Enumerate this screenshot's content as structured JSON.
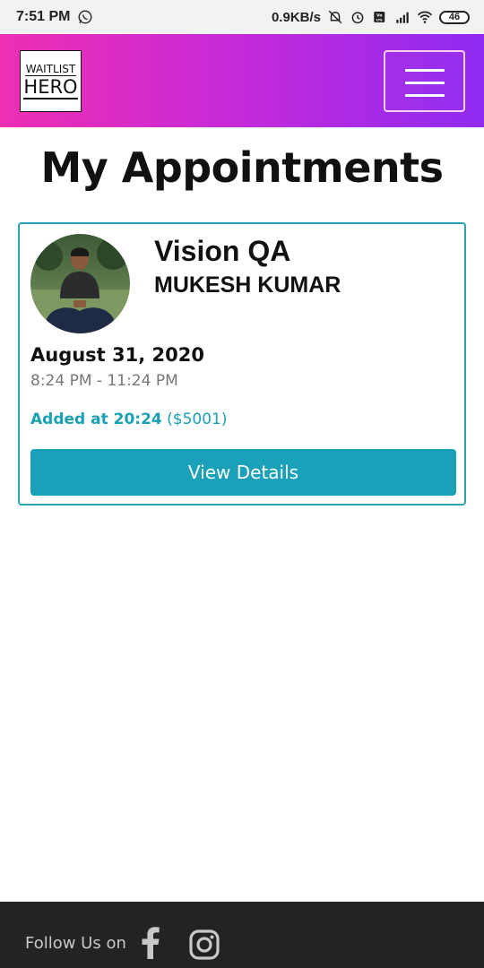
{
  "status_bar": {
    "time": "7:51 PM",
    "network_speed": "0.9KB/s",
    "battery": "46",
    "icons": [
      "whatsapp-icon",
      "mute-notifications-icon",
      "alarm-icon",
      "volte-icon",
      "signal-icon",
      "wifi-icon",
      "battery-icon"
    ]
  },
  "header": {
    "logo_line1": "WAITLIST",
    "logo_line2": "HERO",
    "menu_icon": "hamburger-menu-icon",
    "gradient": [
      "#ee2fb2",
      "#8f2bf2"
    ]
  },
  "page": {
    "title": "My Appointments"
  },
  "appointment": {
    "service": "Vision QA",
    "provider": "MUKESH KUMAR",
    "date": "August 31, 2020",
    "time_range": "8:24 PM - 11:24 PM",
    "added_label": "Added at 20:24",
    "price": "($5001)",
    "button_label": "View Details",
    "accent_color": "#1aa0b8"
  },
  "footer": {
    "follow_text": "Follow Us on",
    "social_icons": [
      "facebook-icon",
      "instagram-icon"
    ]
  }
}
